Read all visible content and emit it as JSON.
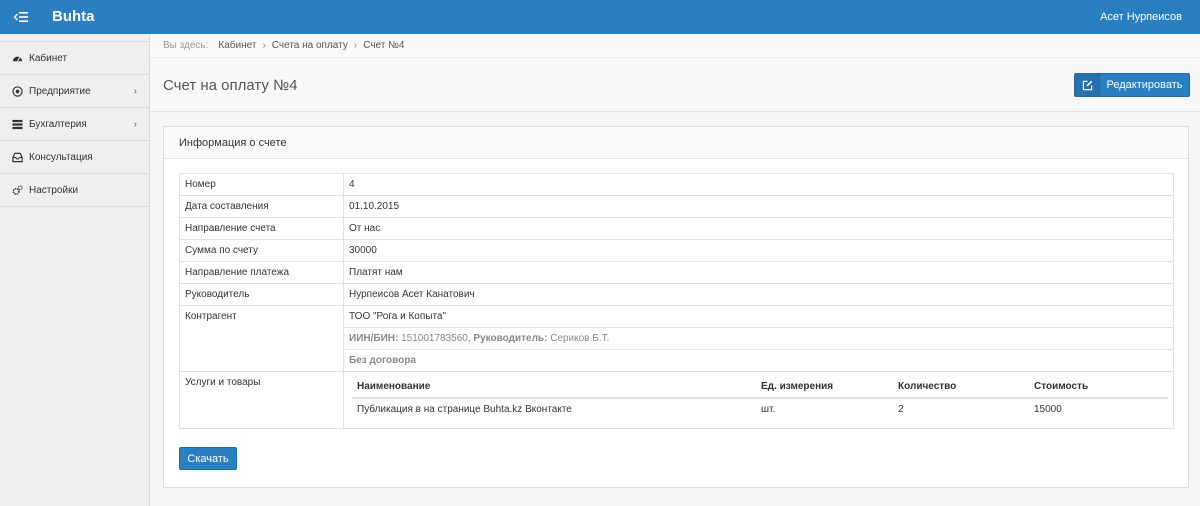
{
  "app": {
    "brand": "Buhta",
    "user": "Асет Нурпеисов"
  },
  "sidebar": {
    "items": [
      {
        "label": "Кабинет",
        "icon": "dashboard-icon"
      },
      {
        "label": "Предприятие",
        "icon": "target-icon",
        "has_children": true
      },
      {
        "label": "Бухгалтерия",
        "icon": "server-icon",
        "has_children": true
      },
      {
        "label": "Консультация",
        "icon": "inbox-icon"
      },
      {
        "label": "Настройки",
        "icon": "cogs-icon"
      }
    ]
  },
  "breadcrumb": {
    "label": "Вы здесь:",
    "items": [
      "Кабинет",
      "Счета на оплату",
      "Счет №4"
    ]
  },
  "page": {
    "title": "Счет на оплату №4",
    "edit_label": "Редактировать"
  },
  "panel": {
    "title": "Информация о счете",
    "download_label": "Скачать"
  },
  "info": {
    "number": {
      "key": "Номер",
      "value": "4"
    },
    "date": {
      "key": "Дата составления",
      "value": "01.10.2015"
    },
    "direction": {
      "key": "Направление счета",
      "value": "От нас"
    },
    "amount": {
      "key": "Сумма по счету",
      "value": "30000"
    },
    "payment_direction": {
      "key": "Направление платежа",
      "value": "Платят нам"
    },
    "head": {
      "key": "Руководитель",
      "value": "Нурпеисов Асет Канатович"
    },
    "counterparty": {
      "key": "Контрагент",
      "name": "ТОО \"Рога и Копыта\"",
      "iin_label": "ИИН/БИН:",
      "iin_value": "151001783560,",
      "head_label": "Руководитель:",
      "head_value": "Сериков Б.Т.",
      "contract": "Без договора"
    },
    "services": {
      "key": "Услуги и товары",
      "columns": [
        "Наименование",
        "Ед. измерения",
        "Количество",
        "Стоимость"
      ],
      "rows": [
        [
          "Публикация в на странице Buhta.kz Вконтакте",
          "шт.",
          "2",
          "15000"
        ]
      ]
    }
  }
}
